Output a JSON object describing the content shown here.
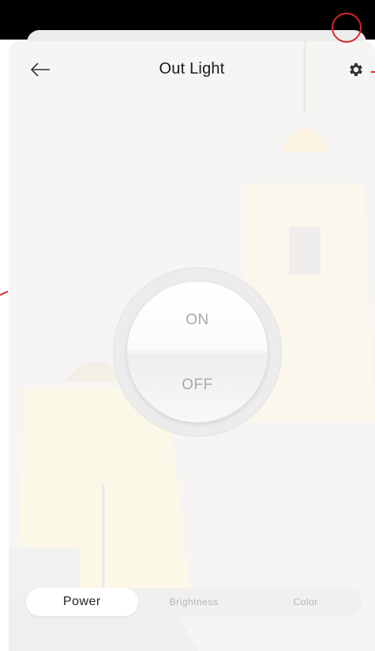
{
  "header": {
    "title": "Out Light",
    "back_icon": "arrow-left-icon",
    "settings_icon": "gear-icon"
  },
  "power_switch": {
    "on_label": "ON",
    "off_label": "OFF"
  },
  "tabs": [
    {
      "label": "Power",
      "active": true
    },
    {
      "label": "Brightness",
      "active": false
    },
    {
      "label": "Color",
      "active": false
    }
  ],
  "colors": {
    "accent_highlight": "#d8262c",
    "background": "#f6f5f3",
    "switch_text": "#a9a9a9"
  }
}
